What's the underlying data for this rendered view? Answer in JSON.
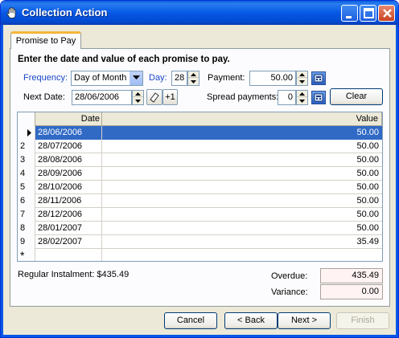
{
  "window": {
    "title": "Collection Action"
  },
  "tab": {
    "label": "Promise to Pay"
  },
  "form": {
    "instruction": "Enter the date and value of each promise to pay.",
    "frequency_label": "Frequency:",
    "frequency_value": "Day of Month",
    "day_label": "Day:",
    "day_value": "28",
    "payment_label": "Payment:",
    "payment_value": "50.00",
    "next_date_label": "Next Date:",
    "next_date_value": "28/06/2006",
    "plus_one_label": "+1",
    "spread_label": "Spread payments:",
    "spread_value": "0",
    "clear_label": "Clear"
  },
  "grid": {
    "columns": [
      "Date",
      "Value"
    ],
    "rows": [
      {
        "num": "",
        "date": "28/06/2006",
        "value": "50.00"
      },
      {
        "num": "2",
        "date": "28/07/2006",
        "value": "50.00"
      },
      {
        "num": "3",
        "date": "28/08/2006",
        "value": "50.00"
      },
      {
        "num": "4",
        "date": "28/09/2006",
        "value": "50.00"
      },
      {
        "num": "5",
        "date": "28/10/2006",
        "value": "50.00"
      },
      {
        "num": "6",
        "date": "28/11/2006",
        "value": "50.00"
      },
      {
        "num": "7",
        "date": "28/12/2006",
        "value": "50.00"
      },
      {
        "num": "8",
        "date": "28/01/2007",
        "value": "50.00"
      },
      {
        "num": "9",
        "date": "28/02/2007",
        "value": "35.49"
      }
    ],
    "new_row_marker": "*"
  },
  "summary": {
    "regular_instalment": "Regular Instalment: $435.49",
    "overdue_label": "Overdue:",
    "overdue_value": "435.49",
    "variance_label": "Variance:",
    "variance_value": "0.00"
  },
  "buttons": {
    "cancel": "Cancel",
    "back": "< Back",
    "next": "Next >",
    "finish": "Finish"
  },
  "colors": {
    "title_bar": "#0558e6",
    "selection": "#316ac5",
    "label_blue": "#1a47c8"
  }
}
